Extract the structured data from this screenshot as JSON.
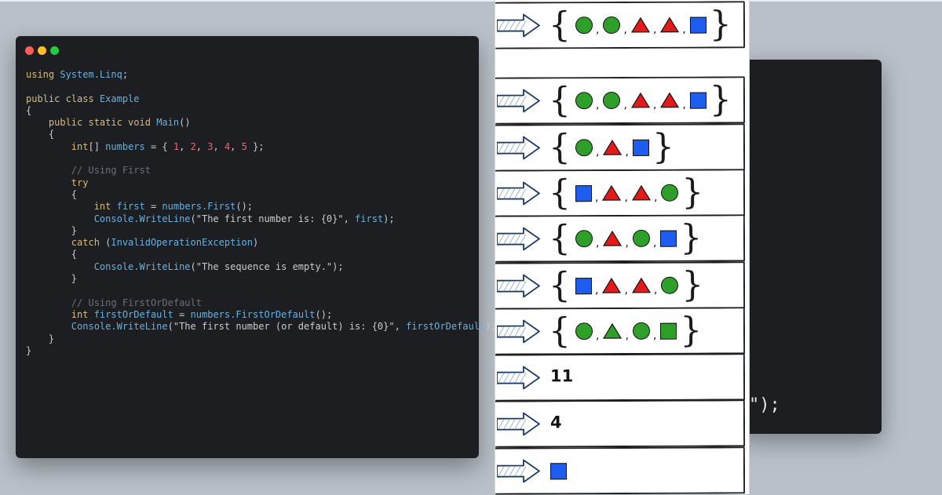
{
  "colors": {
    "background": "#b9c0c8",
    "editor_bg": "#1c1e22",
    "keyword": "#d7ba7d",
    "identifier": "#6ab0de",
    "number": "#e06c75",
    "comment": "#6a6f78",
    "text": "#c8ccd2",
    "green": "#2ea02a",
    "red": "#e21a1a",
    "blue": "#1f5cf0"
  },
  "bg_editor": {
    "visible_text": "\");"
  },
  "editor": {
    "window_controls": [
      "close",
      "minimize",
      "maximize"
    ],
    "code_lines": [
      [
        {
          "c": "kw",
          "t": "using "
        },
        {
          "c": "id",
          "t": "System.Linq"
        },
        {
          "c": "tx",
          "t": ";"
        }
      ],
      [],
      [
        {
          "c": "kw",
          "t": "public class "
        },
        {
          "c": "id",
          "t": "Example"
        }
      ],
      [
        {
          "c": "tx",
          "t": "{"
        }
      ],
      [
        {
          "c": "tx",
          "t": "    "
        },
        {
          "c": "kw",
          "t": "public static void "
        },
        {
          "c": "id",
          "t": "Main"
        },
        {
          "c": "tx",
          "t": "()"
        }
      ],
      [
        {
          "c": "tx",
          "t": "    {"
        }
      ],
      [
        {
          "c": "tx",
          "t": "        "
        },
        {
          "c": "kw",
          "t": "int"
        },
        {
          "c": "tx",
          "t": "[] "
        },
        {
          "c": "id",
          "t": "numbers"
        },
        {
          "c": "tx",
          "t": " = { "
        },
        {
          "c": "num",
          "t": "1"
        },
        {
          "c": "tx",
          "t": ", "
        },
        {
          "c": "num",
          "t": "2"
        },
        {
          "c": "tx",
          "t": ", "
        },
        {
          "c": "num",
          "t": "3"
        },
        {
          "c": "tx",
          "t": ", "
        },
        {
          "c": "num",
          "t": "4"
        },
        {
          "c": "tx",
          "t": ", "
        },
        {
          "c": "num",
          "t": "5"
        },
        {
          "c": "tx",
          "t": " };"
        }
      ],
      [],
      [
        {
          "c": "tx",
          "t": "        "
        },
        {
          "c": "cm",
          "t": "// Using First"
        }
      ],
      [
        {
          "c": "tx",
          "t": "        "
        },
        {
          "c": "kw",
          "t": "try"
        }
      ],
      [
        {
          "c": "tx",
          "t": "        {"
        }
      ],
      [
        {
          "c": "tx",
          "t": "            "
        },
        {
          "c": "kw",
          "t": "int "
        },
        {
          "c": "id",
          "t": "first"
        },
        {
          "c": "tx",
          "t": " = "
        },
        {
          "c": "id",
          "t": "numbers.First"
        },
        {
          "c": "tx",
          "t": "();"
        }
      ],
      [
        {
          "c": "tx",
          "t": "            "
        },
        {
          "c": "id",
          "t": "Console.WriteLine"
        },
        {
          "c": "tx",
          "t": "(\"The first number is: {0}\", "
        },
        {
          "c": "id",
          "t": "first"
        },
        {
          "c": "tx",
          "t": ");"
        }
      ],
      [
        {
          "c": "tx",
          "t": "        }"
        }
      ],
      [
        {
          "c": "tx",
          "t": "        "
        },
        {
          "c": "kw",
          "t": "catch"
        },
        {
          "c": "tx",
          "t": " ("
        },
        {
          "c": "id",
          "t": "InvalidOperationException"
        },
        {
          "c": "tx",
          "t": ")"
        }
      ],
      [
        {
          "c": "tx",
          "t": "        {"
        }
      ],
      [
        {
          "c": "tx",
          "t": "            "
        },
        {
          "c": "id",
          "t": "Console.WriteLine"
        },
        {
          "c": "tx",
          "t": "(\"The sequence is empty.\");"
        }
      ],
      [
        {
          "c": "tx",
          "t": "        }"
        }
      ],
      [],
      [
        {
          "c": "tx",
          "t": "        "
        },
        {
          "c": "cm",
          "t": "// Using FirstOrDefault"
        }
      ],
      [
        {
          "c": "tx",
          "t": "        "
        },
        {
          "c": "kw",
          "t": "int "
        },
        {
          "c": "id",
          "t": "firstOrDefault"
        },
        {
          "c": "tx",
          "t": " = "
        },
        {
          "c": "id",
          "t": "numbers.FirstOrDefault"
        },
        {
          "c": "tx",
          "t": "();"
        }
      ],
      [
        {
          "c": "tx",
          "t": "        "
        },
        {
          "c": "id",
          "t": "Console.WriteLine"
        },
        {
          "c": "tx",
          "t": "(\"The first number (or default) is: {0}\", "
        },
        {
          "c": "id",
          "t": "firstOrDefault"
        },
        {
          "c": "tx",
          "t": ");"
        }
      ],
      [
        {
          "c": "tx",
          "t": "    }"
        }
      ],
      [
        {
          "c": "tx",
          "t": "}"
        }
      ]
    ]
  },
  "diagram": {
    "cards": [
      {
        "type": "set",
        "items": [
          {
            "shape": "circle",
            "color": "green"
          },
          {
            "shape": "circle",
            "color": "green"
          },
          {
            "shape": "triangle",
            "color": "red"
          },
          {
            "shape": "triangle",
            "color": "red"
          },
          {
            "shape": "square",
            "color": "blue"
          }
        ]
      },
      {
        "type": "set",
        "items": [
          {
            "shape": "circle",
            "color": "green"
          },
          {
            "shape": "circle",
            "color": "green"
          },
          {
            "shape": "triangle",
            "color": "red"
          },
          {
            "shape": "triangle",
            "color": "red"
          },
          {
            "shape": "square",
            "color": "blue"
          }
        ]
      },
      {
        "type": "set",
        "items": [
          {
            "shape": "circle",
            "color": "green"
          },
          {
            "shape": "triangle",
            "color": "red"
          },
          {
            "shape": "square",
            "color": "blue"
          }
        ]
      },
      {
        "type": "set",
        "items": [
          {
            "shape": "square",
            "color": "blue"
          },
          {
            "shape": "triangle",
            "color": "red"
          },
          {
            "shape": "triangle",
            "color": "red"
          },
          {
            "shape": "circle",
            "color": "green"
          }
        ]
      },
      {
        "type": "set",
        "items": [
          {
            "shape": "circle",
            "color": "green"
          },
          {
            "shape": "triangle",
            "color": "red"
          },
          {
            "shape": "circle",
            "color": "green"
          },
          {
            "shape": "square",
            "color": "blue"
          }
        ]
      },
      {
        "type": "set",
        "items": [
          {
            "shape": "square",
            "color": "blue"
          },
          {
            "shape": "triangle",
            "color": "red"
          },
          {
            "shape": "triangle",
            "color": "red"
          },
          {
            "shape": "circle",
            "color": "green"
          }
        ]
      },
      {
        "type": "set",
        "items": [
          {
            "shape": "circle",
            "color": "green"
          },
          {
            "shape": "triangle",
            "color": "green"
          },
          {
            "shape": "circle",
            "color": "green"
          },
          {
            "shape": "square",
            "color": "green"
          }
        ]
      },
      {
        "type": "text",
        "value": "11"
      },
      {
        "type": "text",
        "value": "4"
      },
      {
        "type": "shape",
        "items": [
          {
            "shape": "square",
            "color": "blue"
          }
        ]
      }
    ]
  }
}
